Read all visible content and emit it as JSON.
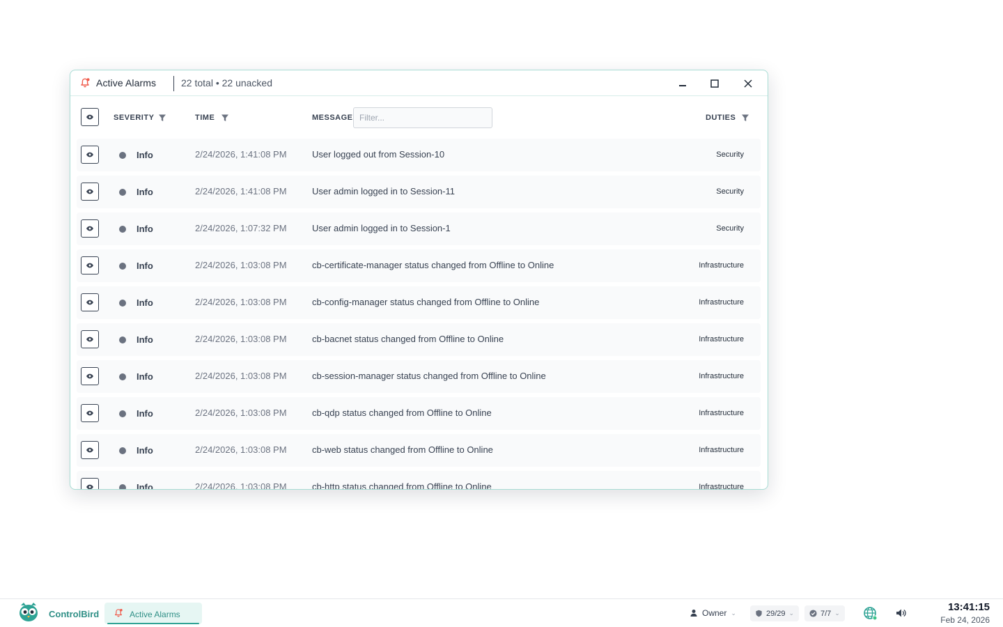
{
  "window": {
    "title": "Active Alarms",
    "count_text": "22 total • 22 unacked"
  },
  "header": {
    "severity_label": "SEVERITY",
    "time_label": "TIME",
    "message_label": "MESSAGE",
    "filter_placeholder": "Filter...",
    "duties_label": "DUTIES"
  },
  "alarms": [
    {
      "severity": "Info",
      "time": "2/24/2026, 1:41:08 PM",
      "message": "User logged out from Session-10",
      "duty": "Security"
    },
    {
      "severity": "Info",
      "time": "2/24/2026, 1:41:08 PM",
      "message": "User admin logged in to Session-11",
      "duty": "Security"
    },
    {
      "severity": "Info",
      "time": "2/24/2026, 1:07:32 PM",
      "message": "User admin logged in to Session-1",
      "duty": "Security"
    },
    {
      "severity": "Info",
      "time": "2/24/2026, 1:03:08 PM",
      "message": "cb-certificate-manager status changed from Offline to Online",
      "duty": "Infrastructure"
    },
    {
      "severity": "Info",
      "time": "2/24/2026, 1:03:08 PM",
      "message": "cb-config-manager status changed from Offline to Online",
      "duty": "Infrastructure"
    },
    {
      "severity": "Info",
      "time": "2/24/2026, 1:03:08 PM",
      "message": "cb-bacnet status changed from Offline to Online",
      "duty": "Infrastructure"
    },
    {
      "severity": "Info",
      "time": "2/24/2026, 1:03:08 PM",
      "message": "cb-session-manager status changed from Offline to Online",
      "duty": "Infrastructure"
    },
    {
      "severity": "Info",
      "time": "2/24/2026, 1:03:08 PM",
      "message": "cb-qdp status changed from Offline to Online",
      "duty": "Infrastructure"
    },
    {
      "severity": "Info",
      "time": "2/24/2026, 1:03:08 PM",
      "message": "cb-web status changed from Offline to Online",
      "duty": "Infrastructure"
    },
    {
      "severity": "Info",
      "time": "2/24/2026, 1:03:08 PM",
      "message": "cb-http status changed from Offline to Online",
      "duty": "Infrastructure"
    }
  ],
  "taskbar": {
    "brand": "ControlBird",
    "active_tab": "Active Alarms",
    "user": "Owner",
    "shield_count": "29/29",
    "check_count": "7/7",
    "clock_time": "13:41:15",
    "clock_date": "Feb 24, 2026"
  },
  "colors": {
    "accent": "#2fa395",
    "window_border": "#a7dcd4",
    "alarm_icon": "#ef5b4c",
    "info_dot": "#6b7280"
  },
  "icons": {
    "window": "bell-alert-icon",
    "row_action": "eye-icon",
    "column_filter": "funnel-icon",
    "user": "person-icon",
    "pill1": "shield-icon",
    "pill2": "check-circle-icon",
    "network": "globe-network-icon",
    "sound": "speaker-icon"
  }
}
